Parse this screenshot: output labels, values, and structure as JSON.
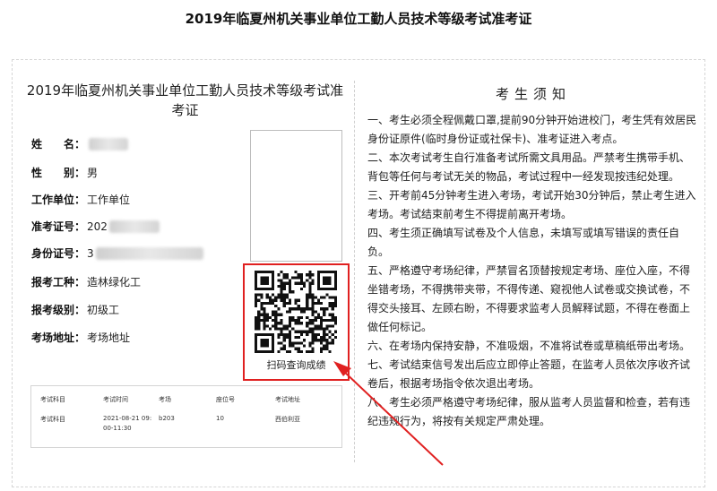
{
  "page_title": "2019年临夏州机关事业单位工勤人员技术等级考试准考证",
  "card": {
    "title": "2019年临夏州机关事业单位工勤人员技术等级考试准考证",
    "fields": [
      {
        "label": "姓　　名：",
        "value": "",
        "redacted": true,
        "width": 44
      },
      {
        "label": "性　　别：",
        "value": "男"
      },
      {
        "label": "工作单位：",
        "value": "工作单位"
      },
      {
        "label": "准考证号：",
        "value": "202",
        "redacted": true,
        "width": 60
      },
      {
        "label": "身份证号：",
        "value": "3",
        "redacted": true,
        "width": 128
      },
      {
        "label": "报考工种：",
        "value": "造林绿化工"
      },
      {
        "label": "报考级别：",
        "value": "初级工"
      },
      {
        "label": "考场地址：",
        "value": "考场地址"
      }
    ],
    "qr_caption": "扫码查询成绩",
    "table": {
      "headers": [
        "考试科目",
        "考试时间",
        "考场",
        "座位号",
        "考试地址"
      ],
      "row": [
        "考试科目",
        "2021-08-21 09:",
        "00-11:30",
        "b203",
        "10",
        "西伯利亚"
      ]
    }
  },
  "notes": {
    "title": "考生须知",
    "items": [
      "一、考生必须全程佩戴口罩,提前90分钟开始进校门，考生凭有效居民身份证原件(临时身份证或社保卡)、准考证进入考点。",
      "二、本次考试考生自行准备考试所需文具用品。严禁考生携带手机、背包等任何与考试无关的物品，考试过程中一经发现按违纪处理。",
      "三、开考前45分钟考生进入考场，考试开始30分钟后，禁止考生进入考场。考试结束前考生不得提前离开考场。",
      "四、考生须正确填写试卷及个人信息，未填写或填写错误的责任自负。",
      "五、严格遵守考场纪律，严禁冒名顶替按规定考场、座位入座，不得坐错考场，不得携带夹带，不得传递、窥视他人试卷或交换试卷，不得交头接耳、左顾右盼，不得要求监考人员解释试题，不得在卷面上做任何标记。",
      "六、在考场内保持安静，不准吸烟，不准将试卷或草稿纸带出考场。",
      "七、考试结束信号发出后应立即停止答题，在监考人员依次序收齐试卷后，根据考场指令依次退出考场。",
      "八、考生必须严格遵守考场纪律，服从监考人员监督和检查，若有违纪违规行为，将按有关规定严肃处理。"
    ]
  },
  "colors": {
    "highlight": "#e02020"
  }
}
